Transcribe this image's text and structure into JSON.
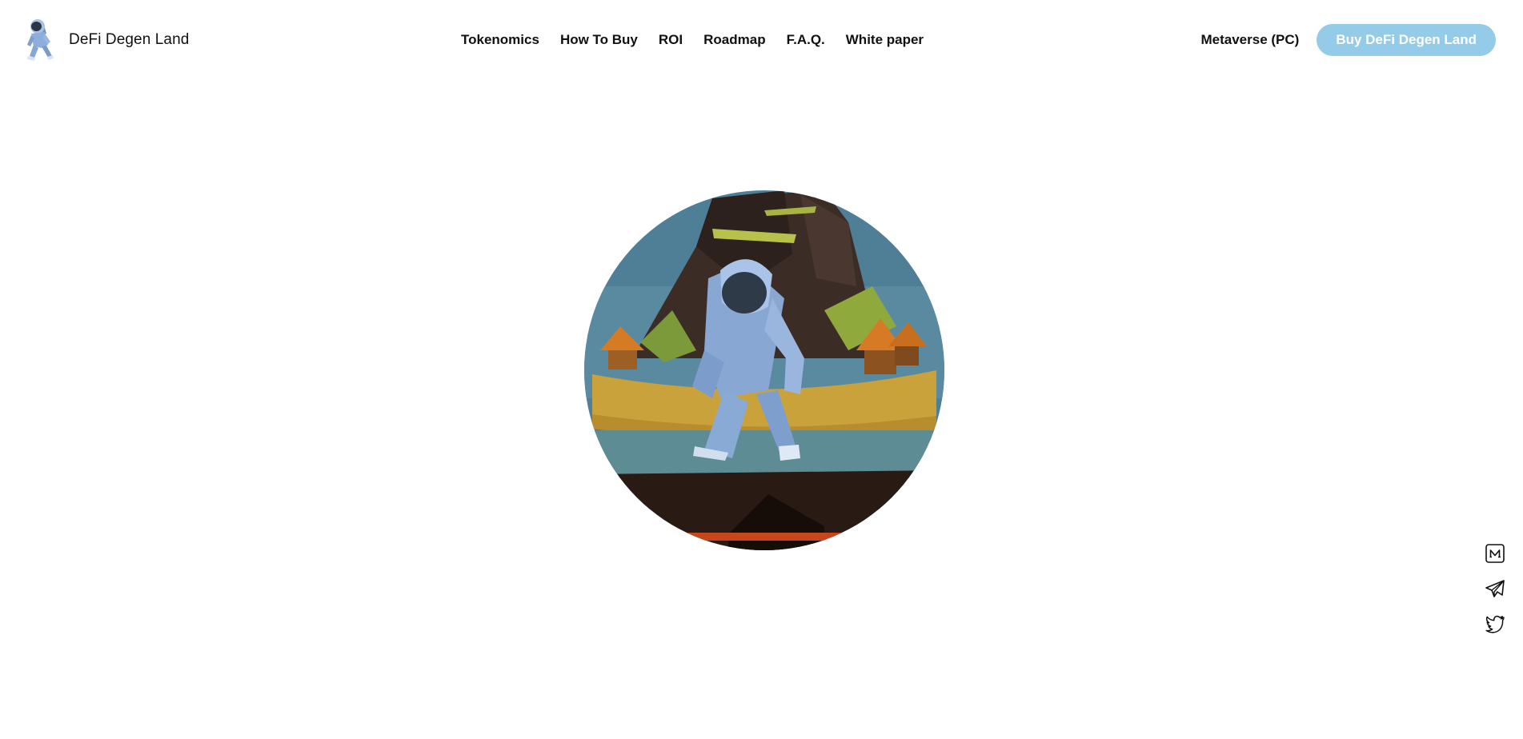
{
  "brand": {
    "name": "DeFi Degen Land",
    "logo_icon": "astronaut-icon"
  },
  "nav": {
    "items": [
      {
        "label": "Tokenomics"
      },
      {
        "label": "How To Buy"
      },
      {
        "label": "ROI"
      },
      {
        "label": "Roadmap"
      },
      {
        "label": "F.A.Q."
      },
      {
        "label": "White paper"
      }
    ]
  },
  "header_actions": {
    "metaverse_label": "Metaverse (PC)",
    "buy_label": "Buy DeFi Degen Land",
    "buy_color": "#94cbe8"
  },
  "hero": {
    "image_icon": "astronaut-island-illustration"
  },
  "social": {
    "items": [
      {
        "icon": "medium-icon"
      },
      {
        "icon": "telegram-icon"
      },
      {
        "icon": "twitter-icon"
      }
    ]
  }
}
